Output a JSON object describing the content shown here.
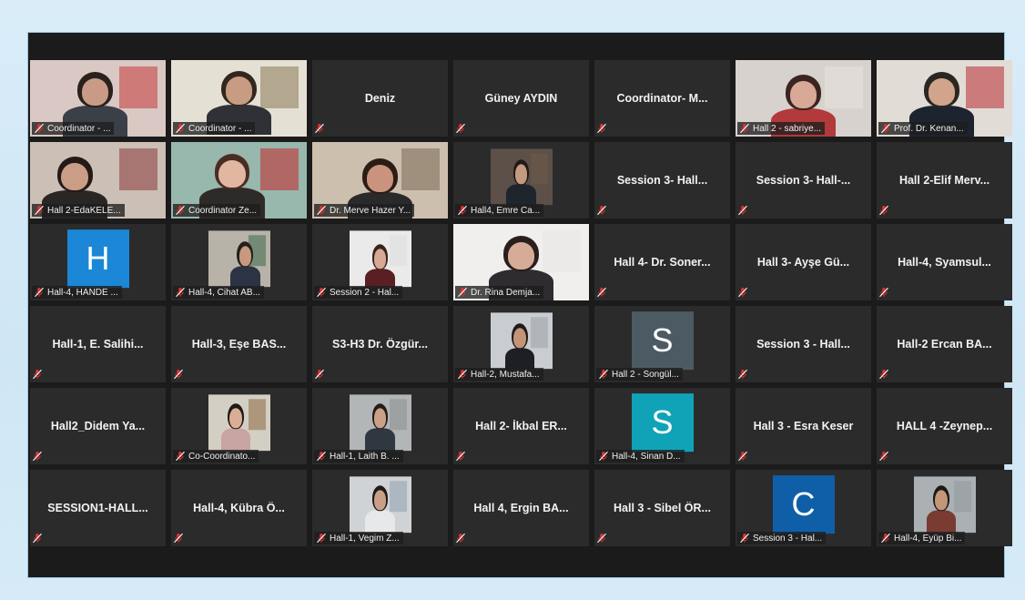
{
  "tiles": [
    {
      "label": "Coordinator - ...",
      "kind": "video",
      "scene": {
        "bg": "#d9c8c4",
        "skin": "#c99b86",
        "hair": "#2a211d",
        "shirt": "#3a3f48",
        "accent": "#c43b3b",
        "hx": 0.48,
        "hy": 0.22
      }
    },
    {
      "label": "Coordinator - ...",
      "kind": "video",
      "scene": {
        "bg": "#e5e0d4",
        "skin": "#c79c82",
        "hair": "#33261f",
        "shirt": "#2f3136",
        "accent": "#8a7a55",
        "hx": 0.5,
        "hy": 0.2
      }
    },
    {
      "label": "Deniz",
      "kind": "name"
    },
    {
      "label": "Güney AYDIN",
      "kind": "name"
    },
    {
      "label": "Coordinator-  M...",
      "kind": "name"
    },
    {
      "label": "Hall 2 - sabriye...",
      "kind": "video",
      "scene": {
        "bg": "#d8d2cf",
        "skin": "#d7a996",
        "hair": "#3a2520",
        "shirt": "#b23a3a",
        "accent": "#e7e2dd",
        "hx": 0.5,
        "hy": 0.25
      }
    },
    {
      "label": "Prof. Dr. Kenan...",
      "kind": "video",
      "scene": {
        "bg": "#e2dcd6",
        "skin": "#d1a58c",
        "hair": "#2b2622",
        "shirt": "#1e2330",
        "accent": "#b82b32",
        "hx": 0.48,
        "hy": 0.22
      }
    },
    {
      "label": "Hall 2-EdaKELE...",
      "kind": "video",
      "scene": {
        "bg": "#cbbfb6",
        "skin": "#c99d86",
        "hair": "#241a17",
        "shirt": "#2a2624",
        "accent": "#8b3b3b",
        "hx": 0.33,
        "hy": 0.25
      }
    },
    {
      "label": "Coordinator Ze...",
      "kind": "video",
      "scene": {
        "bg": "#98b7ad",
        "skin": "#e1b7a2",
        "hair": "#4a2d22",
        "shirt": "#2d2a28",
        "accent": "#c62828",
        "hx": 0.45,
        "hy": 0.22
      }
    },
    {
      "label": "Dr. Merve Hazer Y...",
      "kind": "video",
      "active": true,
      "scene": {
        "bg": "#cdbfae",
        "skin": "#c9937d",
        "hair": "#2c1c16",
        "shirt": "#2a2a2a",
        "accent": "#7a6a58",
        "hx": 0.5,
        "hy": 0.28
      }
    },
    {
      "label": "Hall4, Emre Ca...",
      "kind": "photo",
      "scene": {
        "bg": "#5c5048",
        "skin": "#c49a80",
        "hair": "#201a17",
        "shirt": "#1f252c",
        "accent": "#6e5b4a",
        "hx": 0.5,
        "hy": 0.25
      }
    },
    {
      "label": "Session 3- Hall...",
      "kind": "name"
    },
    {
      "label": "Session 3- Hall-...",
      "kind": "name"
    },
    {
      "label": "Hall 2-Elif Merv...",
      "kind": "name"
    },
    {
      "label": "Hall-4, HANDE ...",
      "kind": "avatar",
      "letter": "H",
      "color": "#1b87d6"
    },
    {
      "label": "Hall-4, Cihat AB...",
      "kind": "photo",
      "scene": {
        "bg": "#b8b2a8",
        "skin": "#c7997e",
        "hair": "#22201d",
        "shirt": "#2b3344",
        "accent": "#3b6b48",
        "hx": 0.6,
        "hy": 0.25
      }
    },
    {
      "label": "Session 2 - Hal...",
      "kind": "photo",
      "scene": {
        "bg": "#eaeaea",
        "skin": "#d5a995",
        "hair": "#3a221b",
        "shirt": "#5a1f22",
        "accent": "#ddd",
        "hx": 0.5,
        "hy": 0.3
      }
    },
    {
      "label": "Dr. Rina Demja...",
      "kind": "video",
      "scene": {
        "bg": "#f0efee",
        "skin": "#d6ab98",
        "hair": "#2a1f1b",
        "shirt": "#2e2c2e",
        "accent": "#e8e6e4",
        "hx": 0.5,
        "hy": 0.22
      }
    },
    {
      "label": "Hall 4- Dr. Soner...",
      "kind": "name"
    },
    {
      "label": "Hall 3- Ayşe Gü...",
      "kind": "name"
    },
    {
      "label": "Hall-4,  Syamsul...",
      "kind": "name"
    },
    {
      "label": "Hall-1,  E. Salihi...",
      "kind": "name"
    },
    {
      "label": "Hall-3, Eşe BAS...",
      "kind": "name"
    },
    {
      "label": "S3-H3  Dr. Özgür...",
      "kind": "name"
    },
    {
      "label": "Hall-2, Mustafa...",
      "kind": "photo",
      "scene": {
        "bg": "#c9ccd0",
        "skin": "#c39478",
        "hair": "#1f1b18",
        "shirt": "#1d1f24",
        "accent": "#9aa3aa",
        "hx": 0.48,
        "hy": 0.25
      }
    },
    {
      "label": "Hall 2 - Songül...",
      "kind": "avatar",
      "letter": "S",
      "color": "#4c5a63"
    },
    {
      "label": "Session 3 - Hall...",
      "kind": "name"
    },
    {
      "label": "Hall-2  Ercan BA...",
      "kind": "name"
    },
    {
      "label": "Hall2_Didem  Ya...",
      "kind": "name"
    },
    {
      "label": "Co-Coordinato...",
      "kind": "photo",
      "scene": {
        "bg": "#d4cfc4",
        "skin": "#d9ae94",
        "hair": "#1f1a18",
        "shirt": "#c8a4a2",
        "accent": "#8a6a44",
        "hx": 0.45,
        "hy": 0.22
      }
    },
    {
      "label": "Hall-1, Laith B. ...",
      "kind": "photo",
      "scene": {
        "bg": "#b3b6b7",
        "skin": "#caa086",
        "hair": "#231d1a",
        "shirt": "#2f3840",
        "accent": "#8c9090",
        "hx": 0.5,
        "hy": 0.22
      }
    },
    {
      "label": "Hall 2-  İkbal ER...",
      "kind": "name"
    },
    {
      "label": "Hall-4, Sinan D...",
      "kind": "avatar",
      "letter": "S",
      "color": "#10a3b8"
    },
    {
      "label": "Hall 3 - Esra Keser",
      "kind": "name"
    },
    {
      "label": "HALL 4 -Zeynep...",
      "kind": "name"
    },
    {
      "label": "SESSION1-HALL...",
      "kind": "name"
    },
    {
      "label": "Hall-4,  Kübra Ö...",
      "kind": "name"
    },
    {
      "label": "Hall-1, Vegim Z...",
      "kind": "photo",
      "scene": {
        "bg": "#d0d3d6",
        "skin": "#c9a087",
        "hair": "#1e1b19",
        "shirt": "#e6e8ea",
        "accent": "#8fa0b1",
        "hx": 0.5,
        "hy": 0.22
      }
    },
    {
      "label": "Hall 4,  Ergin BA...",
      "kind": "name"
    },
    {
      "label": "Hall 3  -  Sibel ÖR...",
      "kind": "name"
    },
    {
      "label": "Session 3 - Hal...",
      "kind": "avatar",
      "letter": "C",
      "color": "#0f5fa8"
    },
    {
      "label": "Hall-4, Eyüp Bi...",
      "kind": "photo",
      "scene": {
        "bg": "#aab0b3",
        "skin": "#c49678",
        "hair": "#1c1816",
        "shirt": "#7a3b33",
        "accent": "#909a9e",
        "hx": 0.45,
        "hy": 0.22
      }
    }
  ],
  "colors": {
    "frame": "#1b1b1b",
    "tile": "#2b2b2b",
    "mic_muted": "#e0312f",
    "active_border": "#d7e36a"
  },
  "icons": {
    "muted": "mic-muted-icon"
  }
}
